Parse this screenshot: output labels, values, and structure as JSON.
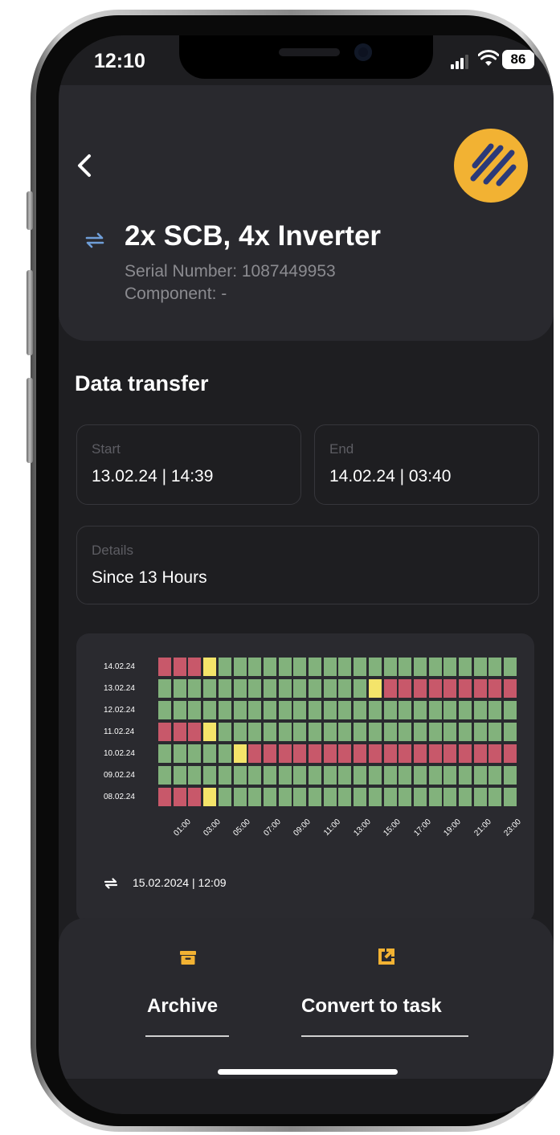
{
  "status_bar": {
    "time": "12:10",
    "battery": "86"
  },
  "header": {
    "title": "2x SCB, 4x Inverter",
    "serial": "Serial Number: 1087449953",
    "component": "Component: -"
  },
  "section": {
    "title": "Data transfer"
  },
  "fields": {
    "start": {
      "label": "Start",
      "value": "13.02.24 | 14:39"
    },
    "end": {
      "label": "End",
      "value": "14.02.24 | 03:40"
    },
    "details": {
      "label": "Details",
      "value": "Since 13 Hours"
    }
  },
  "chart_data": {
    "type": "heatmap",
    "rows": [
      "14.02.24",
      "13.02.24",
      "12.02.24",
      "11.02.24",
      "10.02.24",
      "09.02.24",
      "08.02.24"
    ],
    "columns": [
      "00:00",
      "01:00",
      "02:00",
      "03:00",
      "04:00",
      "05:00",
      "06:00",
      "07:00",
      "08:00",
      "09:00",
      "10:00",
      "11:00",
      "12:00",
      "13:00",
      "14:00",
      "15:00",
      "16:00",
      "17:00",
      "18:00",
      "19:00",
      "20:00",
      "21:00",
      "22:00",
      "23:00"
    ],
    "x_tick_labels": [
      "01:00",
      "03:00",
      "05:00",
      "07:00",
      "09:00",
      "11:00",
      "13:00",
      "15:00",
      "17:00",
      "19:00",
      "21:00",
      "23:00"
    ],
    "status_colors": {
      "ok": "#82b27c",
      "error": "#c8586a",
      "partial": "#f4e46a"
    },
    "cells": [
      [
        "error",
        "error",
        "error",
        "partial",
        "ok",
        "ok",
        "ok",
        "ok",
        "ok",
        "ok",
        "ok",
        "ok",
        "ok",
        "ok",
        "ok",
        "ok",
        "ok",
        "ok",
        "ok",
        "ok",
        "ok",
        "ok",
        "ok",
        "ok"
      ],
      [
        "ok",
        "ok",
        "ok",
        "ok",
        "ok",
        "ok",
        "ok",
        "ok",
        "ok",
        "ok",
        "ok",
        "ok",
        "ok",
        "ok",
        "partial",
        "error",
        "error",
        "error",
        "error",
        "error",
        "error",
        "error",
        "error",
        "error"
      ],
      [
        "ok",
        "ok",
        "ok",
        "ok",
        "ok",
        "ok",
        "ok",
        "ok",
        "ok",
        "ok",
        "ok",
        "ok",
        "ok",
        "ok",
        "ok",
        "ok",
        "ok",
        "ok",
        "ok",
        "ok",
        "ok",
        "ok",
        "ok",
        "ok"
      ],
      [
        "error",
        "error",
        "error",
        "partial",
        "ok",
        "ok",
        "ok",
        "ok",
        "ok",
        "ok",
        "ok",
        "ok",
        "ok",
        "ok",
        "ok",
        "ok",
        "ok",
        "ok",
        "ok",
        "ok",
        "ok",
        "ok",
        "ok",
        "ok"
      ],
      [
        "ok",
        "ok",
        "ok",
        "ok",
        "ok",
        "partial",
        "error",
        "error",
        "error",
        "error",
        "error",
        "error",
        "error",
        "error",
        "error",
        "error",
        "error",
        "error",
        "error",
        "error",
        "error",
        "error",
        "error",
        "error"
      ],
      [
        "ok",
        "ok",
        "ok",
        "ok",
        "ok",
        "ok",
        "ok",
        "ok",
        "ok",
        "ok",
        "ok",
        "ok",
        "ok",
        "ok",
        "ok",
        "ok",
        "ok",
        "ok",
        "ok",
        "ok",
        "ok",
        "ok",
        "ok",
        "ok"
      ],
      [
        "error",
        "error",
        "error",
        "partial",
        "ok",
        "ok",
        "ok",
        "ok",
        "ok",
        "ok",
        "ok",
        "ok",
        "ok",
        "ok",
        "ok",
        "ok",
        "ok",
        "ok",
        "ok",
        "ok",
        "ok",
        "ok",
        "ok",
        "ok"
      ]
    ],
    "last_sync": "15.02.2024 | 12:09"
  },
  "actions": {
    "archive": {
      "label": "Archive",
      "icon": "archive-icon"
    },
    "convert": {
      "label": "Convert to task",
      "icon": "convert-task-icon"
    }
  },
  "colors": {
    "accent": "#f2b233",
    "sync_icon": "#6f9ed8"
  }
}
